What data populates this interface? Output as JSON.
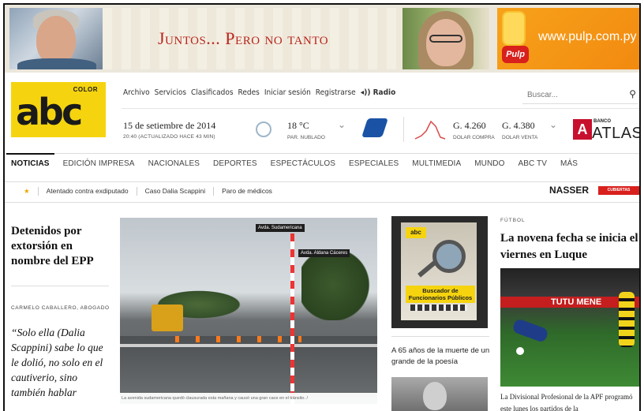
{
  "ad": {
    "title": "Juntos... Pero no tanto",
    "url": "www.pulp.com.py",
    "brand": "Pulp"
  },
  "header": {
    "logo_small": "COLOR",
    "logo": "abc",
    "utility_links": [
      "Archivo",
      "Servicios",
      "Clasificados",
      "Redes",
      "Iniciar sesión",
      "Registrarse"
    ],
    "radio_label": "◂)) Radio",
    "search_placeholder": "Buscar...",
    "date": "15 de setiembre de 2014",
    "updated": "20:40 (ACTUALIZADO HACE 43 MIN)",
    "temp": "18 °C",
    "condition": "PAR. NUBLADO",
    "rate_buy": "G. 4.260",
    "rate_buy_label": "DOLAR COMPRA",
    "rate_sell": "G. 4.380",
    "rate_sell_label": "DOLAR VENTA",
    "bank_small": "BANCO",
    "bank_name": "ATLAS",
    "bank_mark": "A"
  },
  "nav": {
    "items": [
      "NOTICIAS",
      "EDICIÓN IMPRESA",
      "NACIONALES",
      "DEPORTES",
      "ESPECTÁCULOS",
      "ESPECIALES",
      "MULTIMEDIA",
      "MUNDO",
      "ABC TV",
      "MÁS"
    ]
  },
  "trending": {
    "items": [
      "Atentado contra exdiputado",
      "Caso Dalia Scappini",
      "Paro de médicos"
    ],
    "sponsor": "NASSER",
    "sponsor_badge": "CUBIERTAS"
  },
  "left": {
    "title": "Detenidos por extorsión en nombre del EPP",
    "author": "CARMELO CABALLERO, ABOGADO",
    "quote": "“Solo ella (Dalia Scappini) sabe lo que le dolió, no solo en el cautiverio, sino también hablar"
  },
  "main_photo": {
    "sign1": "Avda. Sudamericana",
    "sign2": "Avda. Aldana Cáceres",
    "caption": "La avenida sudamericana quedó clausurada esta mañana y causó una gran caos en el tránsito. /"
  },
  "promo": {
    "mini": "abc",
    "label": "Buscador de Funcionarios Públicos"
  },
  "middle": {
    "title": "A 65 años de la muerte de un grande de la poesía"
  },
  "right": {
    "kicker": "FÚTBOL",
    "title": "La novena fecha se inicia el viernes en Luque",
    "adboard": "TUTU MENE",
    "text": "La Divisional Profesional de la APF programó este lunes los partidos de la"
  },
  "colors": {
    "logo_yellow": "#f5d40f",
    "accent_red": "#b7261d",
    "bank_red": "#c8102e",
    "ad_orange": "#f7a21b"
  }
}
